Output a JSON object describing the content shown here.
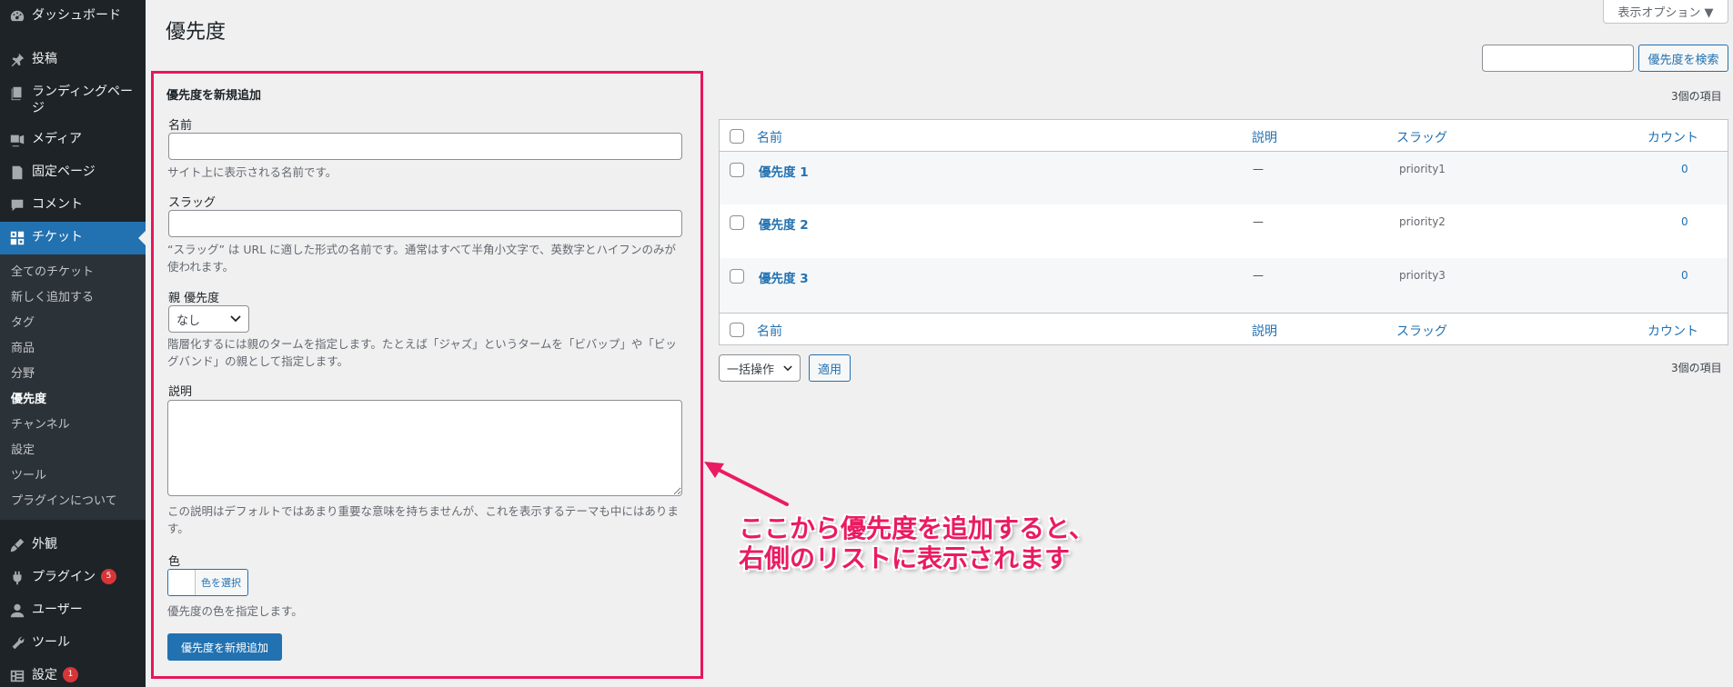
{
  "sidebar": {
    "top_items": [
      {
        "label": "ダッシュボード",
        "icon": "dashboard-icon"
      },
      {
        "label": "投稿",
        "icon": "pin-icon"
      },
      {
        "label": "ランディングページ",
        "icon": "page-stack-icon"
      },
      {
        "label": "メディア",
        "icon": "media-icon"
      },
      {
        "label": "固定ページ",
        "icon": "page-icon"
      },
      {
        "label": "コメント",
        "icon": "comment-icon"
      },
      {
        "label": "チケット",
        "icon": "grid-icon"
      }
    ],
    "submenu": [
      "全てのチケット",
      "新しく追加する",
      "タグ",
      "商品",
      "分野",
      "優先度",
      "チャンネル",
      "設定",
      "ツール",
      "プラグインについて"
    ],
    "submenu_current": "優先度",
    "bottom_items": [
      {
        "label": "外観",
        "icon": "brush-icon",
        "badge": ""
      },
      {
        "label": "プラグイン",
        "icon": "plugin-icon",
        "badge": "5"
      },
      {
        "label": "ユーザー",
        "icon": "user-icon",
        "badge": ""
      },
      {
        "label": "ツール",
        "icon": "wrench-icon",
        "badge": ""
      },
      {
        "label": "設定",
        "icon": "settings-icon",
        "badge": "1"
      }
    ]
  },
  "header": {
    "title": "優先度",
    "screen_options": "表示オプション ▼"
  },
  "search": {
    "value": "",
    "button": "優先度を検索"
  },
  "form": {
    "heading": "優先度を新規追加",
    "name_label": "名前",
    "name_hint": "サイト上に表示される名前です。",
    "slug_label": "スラッグ",
    "slug_hint": "“スラッグ” は URL に適した形式の名前です。通常はすべて半角小文字で、英数字とハイフンのみが使われます。",
    "parent_label": "親 優先度",
    "parent_value": "なし",
    "parent_hint": "階層化するには親のタームを指定します。たとえば「ジャズ」というタームを「ビバップ」や「ビッグバンド」の親として指定します。",
    "description_label": "説明",
    "description_hint": "この説明はデフォルトではあまり重要な意味を持ちませんが、これを表示するテーマも中にはあります。",
    "color_label": "色",
    "color_button": "色を選択",
    "color_hint": "優先度の色を指定します。",
    "submit": "優先度を新規追加"
  },
  "table": {
    "items_count": "3個の項目",
    "columns": [
      "名前",
      "説明",
      "スラッグ",
      "カウント"
    ],
    "rows": [
      {
        "name": "優先度 1",
        "description": "—",
        "slug": "priority1",
        "count": "0"
      },
      {
        "name": "優先度 2",
        "description": "—",
        "slug": "priority2",
        "count": "0"
      },
      {
        "name": "優先度 3",
        "description": "—",
        "slug": "priority3",
        "count": "0"
      }
    ],
    "bulk_action": "一括操作",
    "apply": "適用"
  },
  "annotation": {
    "text": "ここから優先度を追加すると、\n右側のリストに表示されます",
    "color": "#ea1b62"
  }
}
